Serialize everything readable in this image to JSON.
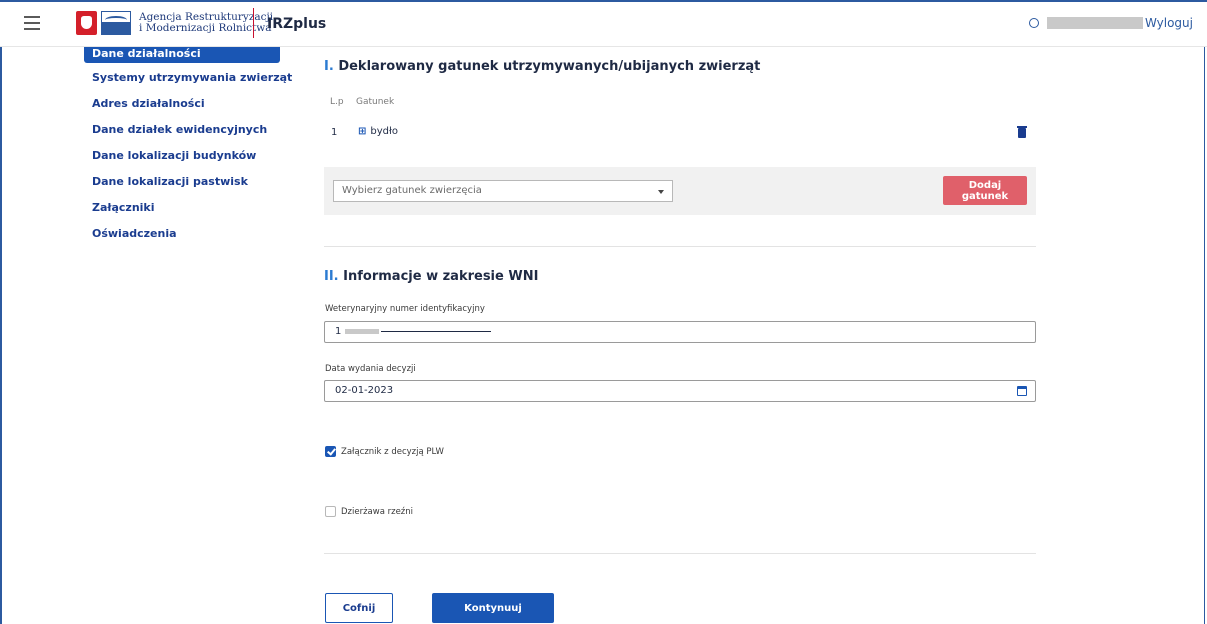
{
  "header": {
    "menu_icon": "hamburger-menu-icon",
    "logo_text_line1": "Agencja Restrukturyzacji",
    "logo_text_line2": "i Modernizacji Rolnictwa",
    "app_name": "IRZplus",
    "user_icon": "user-circle-icon",
    "logout_label": "Wyloguj"
  },
  "sidebar": {
    "items": [
      {
        "label": "Dane działalności",
        "active": true
      },
      {
        "label": "Systemy utrzymywania zwierząt"
      },
      {
        "label": "Adres działalności"
      },
      {
        "label": "Dane działek ewidencyjnych"
      },
      {
        "label": "Dane lokalizacji budynków"
      },
      {
        "label": "Dane lokalizacji pastwisk"
      },
      {
        "label": "Załączniki"
      },
      {
        "label": "Oświadczenia"
      }
    ]
  },
  "section1": {
    "num": "I.",
    "title": "Deklarowany gatunek utrzymywanych/ubijanych zwierząt",
    "col_lp": "L.p",
    "col_species": "Gatunek",
    "rows": [
      {
        "lp": "1",
        "species": "bydło",
        "icon": "cow-icon"
      }
    ],
    "select_placeholder": "Wybierz gatunek zwierzęcia",
    "add_button": "Dodaj gatunek"
  },
  "section2": {
    "num": "II.",
    "title": "Informacje w zakresie WNI",
    "wni_label": "Weterynaryjny numer identyfikacyjny",
    "wni_value_prefix": "1",
    "date_label": "Data wydania decyzji",
    "date_value": "02-01-2023",
    "checkbox1_label": "Załącznik z decyzją PLW",
    "checkbox1_checked": true,
    "checkbox2_label": "Dzierżawa rzeźni",
    "checkbox2_checked": false
  },
  "actions": {
    "back_label": "Cofnij",
    "next_label": "Kontynuuj"
  },
  "colors": {
    "primary": "#1a56b4",
    "accent_red": "#e0606a",
    "brand_red": "#c8102e"
  }
}
